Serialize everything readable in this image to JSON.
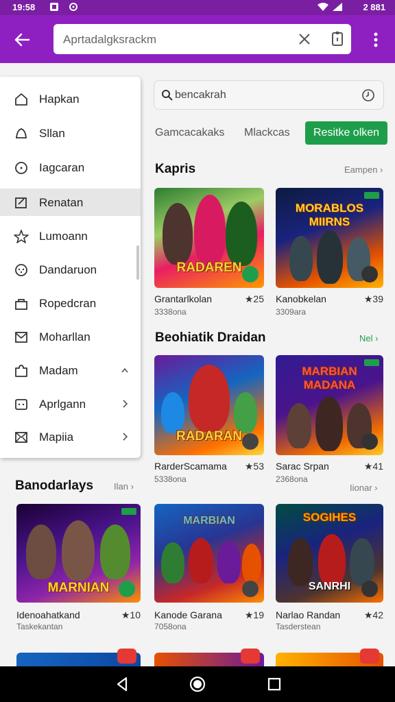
{
  "status": {
    "time": "19:58",
    "right_text": "2 881"
  },
  "appbar": {
    "search_text": "Aprtadalgksrackm"
  },
  "search": {
    "text": "bencakrah"
  },
  "chips": [
    {
      "label": "Gamcacakaks"
    },
    {
      "label": "Mlackcas"
    },
    {
      "label": "Resitke olken"
    }
  ],
  "section1": {
    "title": "Kapris",
    "link": "Eampen",
    "cards": [
      {
        "art": "RADAREN",
        "name": "Grantarlkolan",
        "rating": "★25",
        "sub": "3338ona"
      },
      {
        "art": "MORABLOS MIIRNS",
        "name": "Kanobkelan",
        "rating": "★39",
        "sub": "3309ara"
      }
    ]
  },
  "section2": {
    "title": "Beohiatik Draidan",
    "link": "Nel",
    "link2": "Iionar",
    "cards": [
      {
        "art": "RADARAN",
        "name": "RarderScamama",
        "rating": "★53",
        "sub": "5338ona"
      },
      {
        "art": "MARBIAN MADANA",
        "name": "Sarac Srpan",
        "rating": "★41",
        "sub": "2368ona"
      }
    ]
  },
  "section3": {
    "title": "Banodarlays",
    "link": "Ilan",
    "cards": [
      {
        "art": "MARNIAN",
        "name": "Idenoahatkand",
        "rating": "★10",
        "sub": "Taskekantan"
      },
      {
        "art": "MARBIAN",
        "name": "Kanode Garana",
        "rating": "★19",
        "sub": "7058ona"
      },
      {
        "art": "SANRHI",
        "name": "Narlao Randan",
        "rating": "★42",
        "sub": "Tasderstean"
      }
    ]
  },
  "drawer": {
    "items": [
      {
        "label": "Hapkan",
        "icon": "home-icon"
      },
      {
        "label": "Sllan",
        "icon": "bell-icon"
      },
      {
        "label": "Iagcaran",
        "icon": "clock-icon"
      },
      {
        "label": "Renatan",
        "icon": "edit-icon"
      },
      {
        "label": "Lumoann",
        "icon": "star-icon"
      },
      {
        "label": "Dandaruon",
        "icon": "gamepad-icon"
      },
      {
        "label": "Ropedcran",
        "icon": "bag-icon"
      },
      {
        "label": "Moharllan",
        "icon": "mail-icon"
      },
      {
        "label": "Madam",
        "icon": "puzzle-icon"
      },
      {
        "label": "Aprlgann",
        "icon": "dots-icon"
      },
      {
        "label": "Mapiia",
        "icon": "envelope-icon"
      }
    ]
  }
}
